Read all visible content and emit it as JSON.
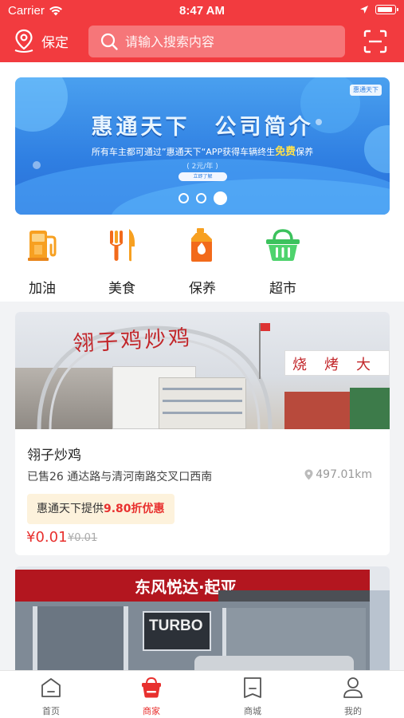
{
  "status_bar": {
    "carrier": "Carrier",
    "time": "8:47 AM"
  },
  "nav": {
    "location": "保定",
    "search_placeholder": "请输入搜索内容",
    "icons": [
      "location-pin-icon",
      "search-icon",
      "scan-icon"
    ]
  },
  "banner": {
    "title": "惠通天下　公司简介",
    "subtitle_prefix": "所有车主都可通过”惠通天下“APP获得车辆终生",
    "subtitle_free": "免费",
    "subtitle_suffix": "保养",
    "price_note": "( 2元/年 )",
    "button_label": "立即了解",
    "logo_text": "惠通天下",
    "slide_count": 3,
    "active_slide": 3,
    "colors": {
      "primary": "#2f7fe2",
      "highlight": "#ffe14a"
    }
  },
  "categories": [
    {
      "label": "加油",
      "icon": "fuel-pump-icon"
    },
    {
      "label": "美食",
      "icon": "fork-knife-icon"
    },
    {
      "label": "保养",
      "icon": "oil-can-icon"
    },
    {
      "label": "超市",
      "icon": "shopping-basket-icon"
    }
  ],
  "shops": [
    {
      "name": "翎子炒鸡",
      "sold": "已售26",
      "address": "通达路与清河南路交叉口西南",
      "distance": "497.01km",
      "promo_prefix": "惠通天下提供",
      "promo_discount": "9.80折优惠",
      "price": "¥0.01",
      "original_price": "¥0.01",
      "photo_sign_text": "翎子鸡炒鸡",
      "photo_side_text": "烧烤大"
    },
    {
      "photo_sign_text": "东风悦达·起亚",
      "photo_banner_text": "TURBO"
    }
  ],
  "tabbar": [
    {
      "label": "首页",
      "icon": "home-icon",
      "active": false
    },
    {
      "label": "商家",
      "icon": "shop-basket-icon",
      "active": true
    },
    {
      "label": "商城",
      "icon": "mall-icon",
      "active": false
    },
    {
      "label": "我的",
      "icon": "profile-icon",
      "active": false
    }
  ],
  "colors": {
    "brand_red": "#f23b3f",
    "price_red": "#e8302e",
    "promo_bg": "#fdf2dc"
  }
}
